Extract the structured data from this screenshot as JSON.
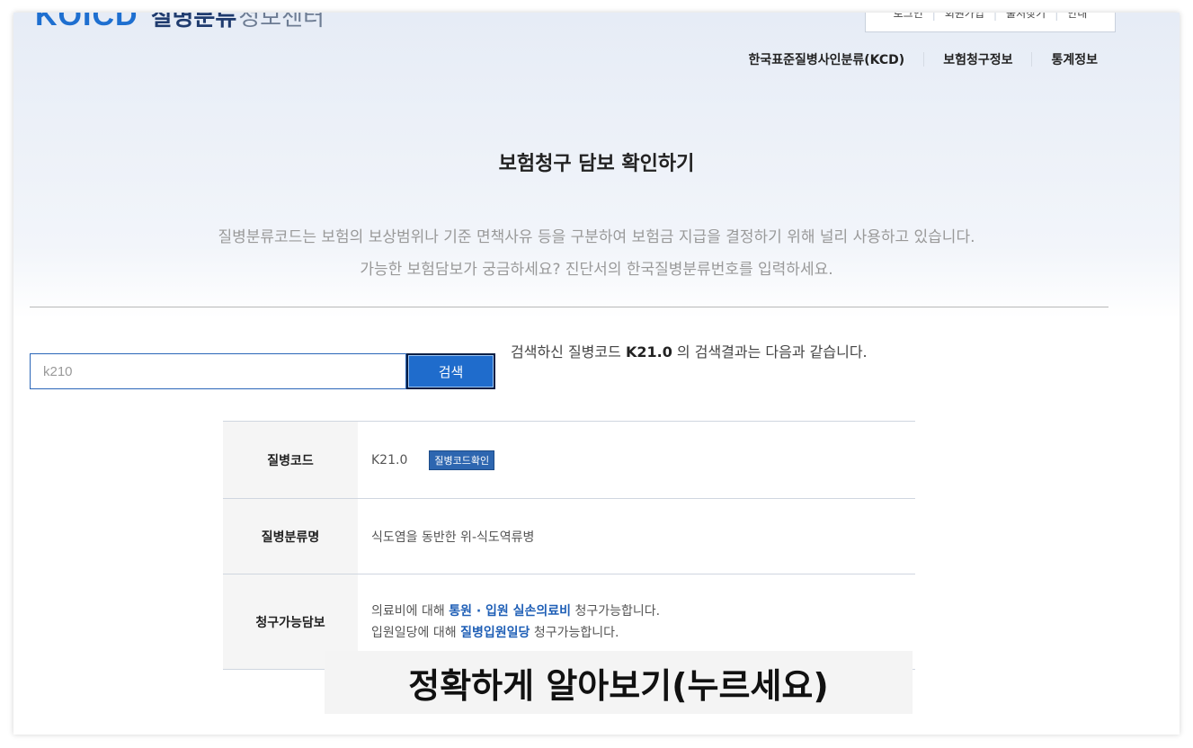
{
  "header": {
    "logo_mark": "KOICD",
    "logo_name_strong": "질병분류",
    "logo_name_light": "정보센터",
    "util_links": [
      "로그인",
      "회원가입",
      "출처찾기",
      "안내"
    ],
    "nav": [
      "한국표준질병사인분류(KCD)",
      "보험청구정보",
      "통계정보"
    ]
  },
  "main": {
    "title": "보험청구 담보 확인하기",
    "desc_line1": "질병분류코드는 보험의 보상범위나 기준 면책사유 등을 구분하여 보험금 지급을 결정하기 위해 널리 사용하고 있습니다.",
    "desc_line2": "가능한 보험담보가 궁금하세요? 진단서의 한국질병분류번호를 입력하세요."
  },
  "search": {
    "value": "k210",
    "button_label": "검색",
    "result_prefix": "검색하신 질병코드",
    "result_code": "K21.0",
    "result_suffix": "의 검색결과는 다음과 같습니다."
  },
  "result": {
    "code_header": "질병코드",
    "code_value": "K21.0",
    "code_badge": "질병코드확인",
    "name_header": "질병분류명",
    "name_value": "식도염을 동반한 위-식도역류병",
    "claim_header": "청구가능담보",
    "claim_line1_prefix": "의료비에 대해",
    "claim_line1_highlight": "통원 · 입원 실손의료비",
    "claim_line1_suffix": "청구가능합니다.",
    "claim_line2_prefix": "입원일당에 대해",
    "claim_line2_highlight": "질병입원일당",
    "claim_line2_suffix": "청구가능합니다."
  },
  "overlay_label": "정확하게 알아보기(누르세요)",
  "colors": {
    "brand": "#1e6fd0",
    "button": "#1f6ccc",
    "highlight": "#1f5fb6",
    "badge": "#2d66b0"
  }
}
